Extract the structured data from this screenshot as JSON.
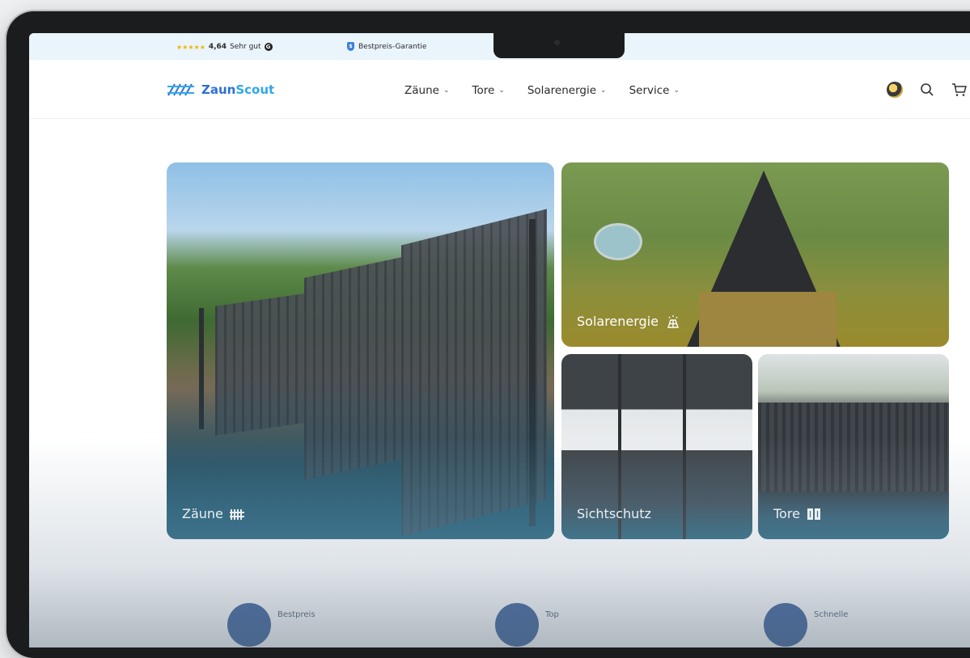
{
  "topbar": {
    "stars": "★★★★★",
    "rating_value": "4,64",
    "rating_text": "Sehr gut",
    "google_badge": "G",
    "guarantee_text": "Bestpreis-Garantie"
  },
  "brand": {
    "name_part1": "Zaun",
    "name_part2": "Scout"
  },
  "nav": {
    "items": [
      {
        "label": "Zäune"
      },
      {
        "label": "Tore"
      },
      {
        "label": "Solarenergie"
      },
      {
        "label": "Service"
      }
    ],
    "chevron": "⌄"
  },
  "tiles": {
    "zaeune": {
      "label": "Zäune"
    },
    "solar": {
      "label": "Solarenergie"
    },
    "sichtschutz": {
      "label": "Sichtschutz"
    },
    "tore": {
      "label": "Tore"
    }
  },
  "features": [
    {
      "label": "Bestpreis"
    },
    {
      "label": "Top"
    },
    {
      "label": "Schnelle"
    }
  ],
  "colors": {
    "accent": "#2f6fd8",
    "accent_light": "#30a8e8",
    "topbar_bg": "#eaf4fb",
    "tile_tint": "#1e5f79"
  }
}
